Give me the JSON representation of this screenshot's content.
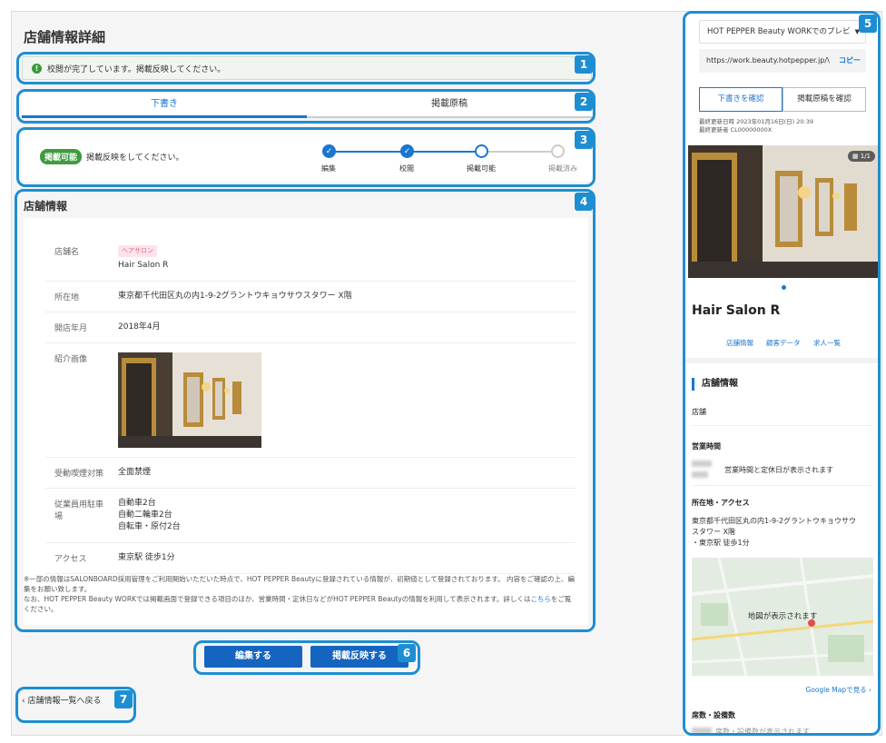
{
  "page": {
    "title": "店舗情報詳細"
  },
  "notice": {
    "icon": "exclamation-icon",
    "text": "校閲が完了しています。掲載反映してください。"
  },
  "tabs": [
    {
      "label": "下書き",
      "active": true
    },
    {
      "label": "掲載原稿",
      "active": false
    }
  ],
  "status": {
    "badge": "掲載可能",
    "text": "掲載反映をしてください。",
    "steps": [
      {
        "label": "編集",
        "state": "done"
      },
      {
        "label": "校閲",
        "state": "done"
      },
      {
        "label": "掲載可能",
        "state": "current"
      },
      {
        "label": "掲載済み",
        "state": "todo"
      }
    ]
  },
  "info": {
    "heading": "店舗情報",
    "rows": {
      "name": {
        "label": "店舗名",
        "genre": "ヘアサロン",
        "value": "Hair Salon R"
      },
      "address": {
        "label": "所在地",
        "value": "東京都千代田区丸の内1-9-2グラントウキョウサウスタワー X階"
      },
      "opened": {
        "label": "開店年月",
        "value": "2018年4月"
      },
      "image": {
        "label": "紹介画像"
      },
      "smoking": {
        "label": "受動喫煙対策",
        "value": "全面禁煙"
      },
      "parking": {
        "label": "従業員用駐車場",
        "lines": [
          "自動車2台",
          "自動二輪車2台",
          "自転車・原付2台"
        ]
      },
      "access": {
        "label": "アクセス",
        "value": "東京駅 徒歩1分"
      }
    },
    "footnote": {
      "line1": "※一部の情報はSALONBOARD採用管理をご利用開始いただいた時点で、HOT PEPPER Beautyに登録されている情報が、初期値として登録されております。 内容をご確認の上、編集をお願い致します。",
      "line2": "なお、HOT PEPPER Beauty WORKでは掲載画面で登録できる項目のほか、営業時間・定休日などがHOT PEPPER Beautyの情報を利用して表示されます。詳しくは",
      "link": "こちら",
      "line3": "をご覧ください。"
    }
  },
  "actions": {
    "edit": "編集する",
    "publish": "掲載反映する"
  },
  "back": {
    "label": "店舗情報一覧へ戻る"
  },
  "preview": {
    "select": "HOT PEPPER Beauty WORKでのプレビ",
    "url": "https://work.beauty.hotpepper.jp/\\",
    "copy": "コピー",
    "check_draft": "下書きを確認",
    "check_published": "掲載原稿を確認",
    "updated_at": "最終更新日時  2023年01月16日(日) 20:39",
    "updated_by": "最終更新者    CL00000000X",
    "counter": "1/1",
    "salon_name": "Hair Salon R",
    "nav": [
      "店舗情報",
      "顧客データ",
      "求人一覧"
    ],
    "section": "店舗情報",
    "store_label": "店舗",
    "hours_label": "営業時間",
    "hours_text": "営業時間と定休日が表示されます",
    "access_label": "所在地・アクセス",
    "access_lines": [
      "東京都千代田区丸の内1-9-2グラントウキョウサウ",
      "スタワー X階",
      "・東京駅 徒歩1分"
    ],
    "map_text": "地図が表示されます",
    "gmap_link": "Google Mapで見る",
    "seats_label": "席数・設備数",
    "seats_text": "席数・設備数が表示されます"
  },
  "callouts": [
    "1",
    "2",
    "3",
    "4",
    "5",
    "6",
    "7"
  ]
}
